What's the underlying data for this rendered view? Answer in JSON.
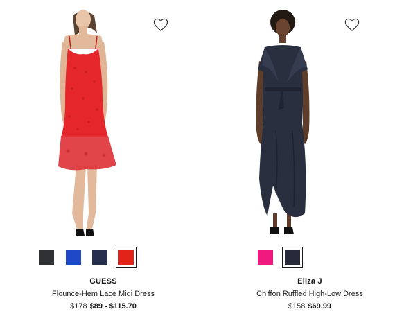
{
  "products": [
    {
      "brand": "GUESS",
      "name": "Flounce-Hem Lace Midi Dress",
      "original_price": "$178",
      "sale_price": "$89 - $115.70",
      "dress_color": "#e5262a",
      "swatches": [
        {
          "color": "#2f3235",
          "selected": false
        },
        {
          "color": "#1f48c9",
          "selected": false
        },
        {
          "color": "#25304f",
          "selected": false
        },
        {
          "color": "#e2231a",
          "selected": true
        }
      ]
    },
    {
      "brand": "Eliza J",
      "name": "Chiffon Ruffled High-Low Dress",
      "original_price": "$158",
      "sale_price": "$69.99",
      "dress_color": "#2a2f3f",
      "swatches": [
        {
          "color": "#f0197d",
          "selected": false
        },
        {
          "color": "#262a3b",
          "selected": true
        }
      ]
    }
  ],
  "icons": {
    "favorite": "heart-outline-icon"
  }
}
